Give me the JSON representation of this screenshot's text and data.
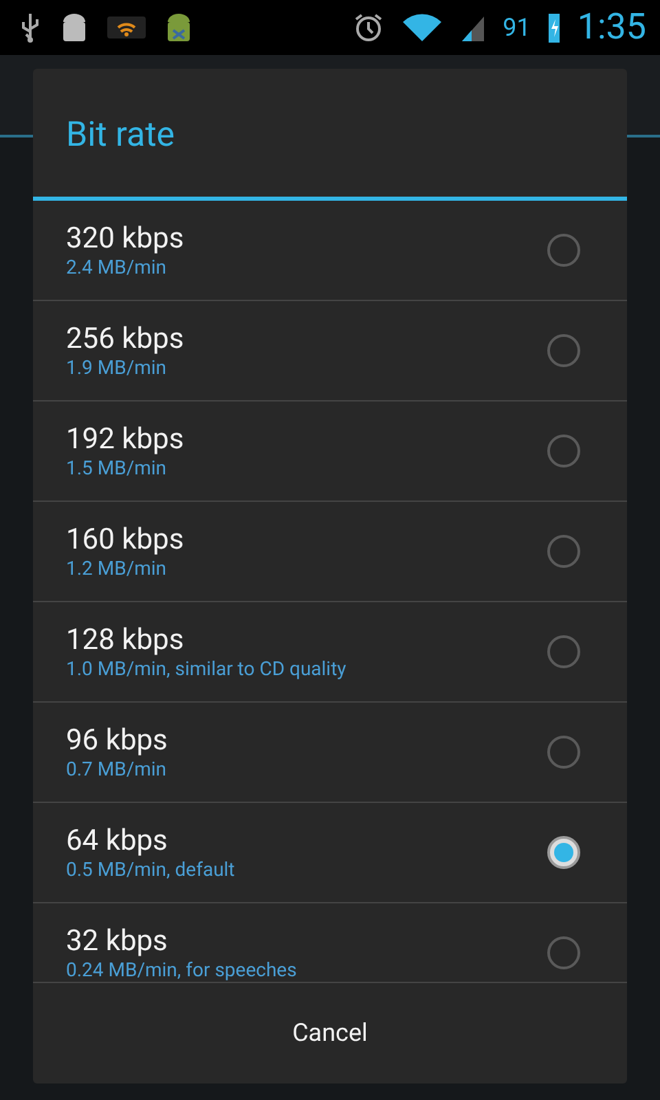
{
  "status_bar": {
    "battery_percent": "91",
    "time": "1:35"
  },
  "dialog": {
    "title": "Bit rate",
    "options": [
      {
        "label": "320 kbps",
        "detail": "2.4 MB/min",
        "selected": false
      },
      {
        "label": "256 kbps",
        "detail": "1.9 MB/min",
        "selected": false
      },
      {
        "label": "192 kbps",
        "detail": "1.5 MB/min",
        "selected": false
      },
      {
        "label": "160 kbps",
        "detail": "1.2 MB/min",
        "selected": false
      },
      {
        "label": "128 kbps",
        "detail": "1.0 MB/min, similar to CD quality",
        "selected": false
      },
      {
        "label": "96 kbps",
        "detail": "0.7 MB/min",
        "selected": false
      },
      {
        "label": "64 kbps",
        "detail": "0.5 MB/min, default",
        "selected": true
      },
      {
        "label": "32 kbps",
        "detail": "0.24 MB/min, for speeches",
        "selected": false
      }
    ],
    "buttons": [
      "Cancel"
    ]
  }
}
